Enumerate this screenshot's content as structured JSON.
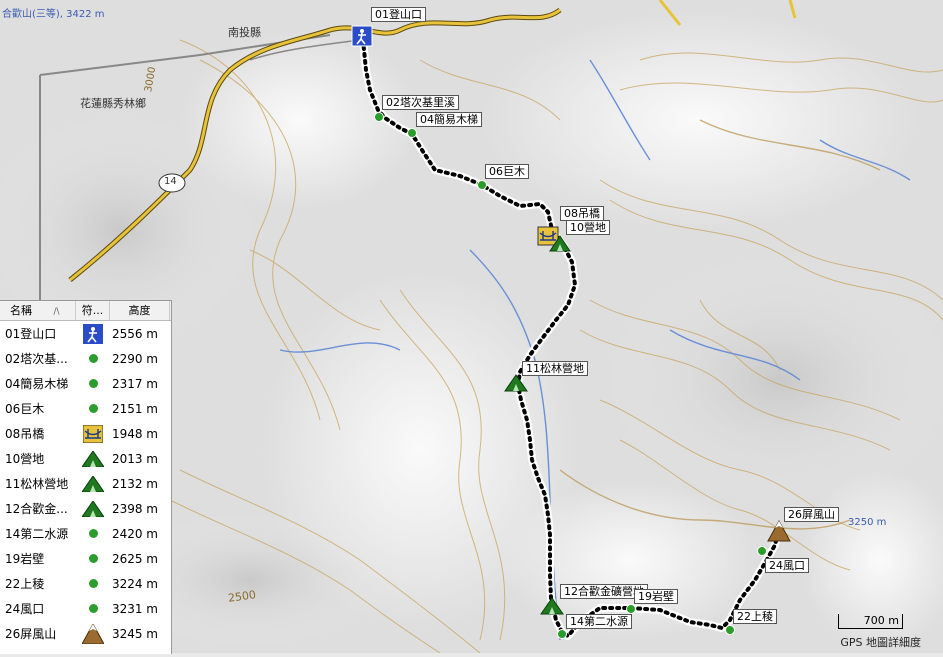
{
  "map": {
    "top_label": "合歡山(三等), 3422 m",
    "county_label": "南投縣",
    "township_label": "花蓮縣秀林鄉",
    "road_number": "14",
    "contour_3000": "3000",
    "contour_2500": "2500",
    "peak_alt_label": "3250 m",
    "scale_label": "700 m",
    "credit": "GPS 地圖詳細度"
  },
  "map_labels": [
    {
      "id": "01",
      "text": "01登山口"
    },
    {
      "id": "02",
      "text": "02塔次基里溪"
    },
    {
      "id": "04",
      "text": "04簡易木梯"
    },
    {
      "id": "06",
      "text": "06巨木"
    },
    {
      "id": "08",
      "text": "08吊橋"
    },
    {
      "id": "10",
      "text": "10營地"
    },
    {
      "id": "11",
      "text": "11松林營地"
    },
    {
      "id": "12",
      "text": "12合歡金礦營地"
    },
    {
      "id": "14",
      "text": "14第二水源"
    },
    {
      "id": "19",
      "text": "19岩壁"
    },
    {
      "id": "22",
      "text": "22上稜"
    },
    {
      "id": "24",
      "text": "24風口"
    },
    {
      "id": "26",
      "text": "26屏風山"
    }
  ],
  "waypoint_list": {
    "headers": {
      "name": "名稱",
      "sort": "/\\",
      "symbol": "符...",
      "altitude": "高度"
    },
    "rows": [
      {
        "name": "01登山口",
        "symbol": "hiker-icon",
        "altitude": "2556 m"
      },
      {
        "name": "02塔次基...",
        "symbol": "green-dot-icon",
        "altitude": "2290 m"
      },
      {
        "name": "04簡易木梯",
        "symbol": "green-dot-icon",
        "altitude": "2317 m"
      },
      {
        "name": "06巨木",
        "symbol": "green-dot-icon",
        "altitude": "2151 m"
      },
      {
        "name": "08吊橋",
        "symbol": "bridge-icon",
        "altitude": "1948 m"
      },
      {
        "name": "10營地",
        "symbol": "tent-icon",
        "altitude": "2013 m"
      },
      {
        "name": "11松林營地",
        "symbol": "tent-icon",
        "altitude": "2132 m"
      },
      {
        "name": "12合歡金...",
        "symbol": "tent-icon",
        "altitude": "2398 m"
      },
      {
        "name": "14第二水源",
        "symbol": "green-dot-icon",
        "altitude": "2420 m"
      },
      {
        "name": "19岩壁",
        "symbol": "green-dot-icon",
        "altitude": "2625 m"
      },
      {
        "name": "22上稜",
        "symbol": "green-dot-icon",
        "altitude": "3224 m"
      },
      {
        "name": "24風口",
        "symbol": "green-dot-icon",
        "altitude": "3231 m"
      },
      {
        "name": "26屏風山",
        "symbol": "summit-icon",
        "altitude": "3245 m"
      }
    ]
  },
  "colors": {
    "track": "#000000",
    "waypoint_green": "#2a9d2a",
    "road_yellow": "#e8c33a",
    "river_blue": "#6a8fd6"
  }
}
